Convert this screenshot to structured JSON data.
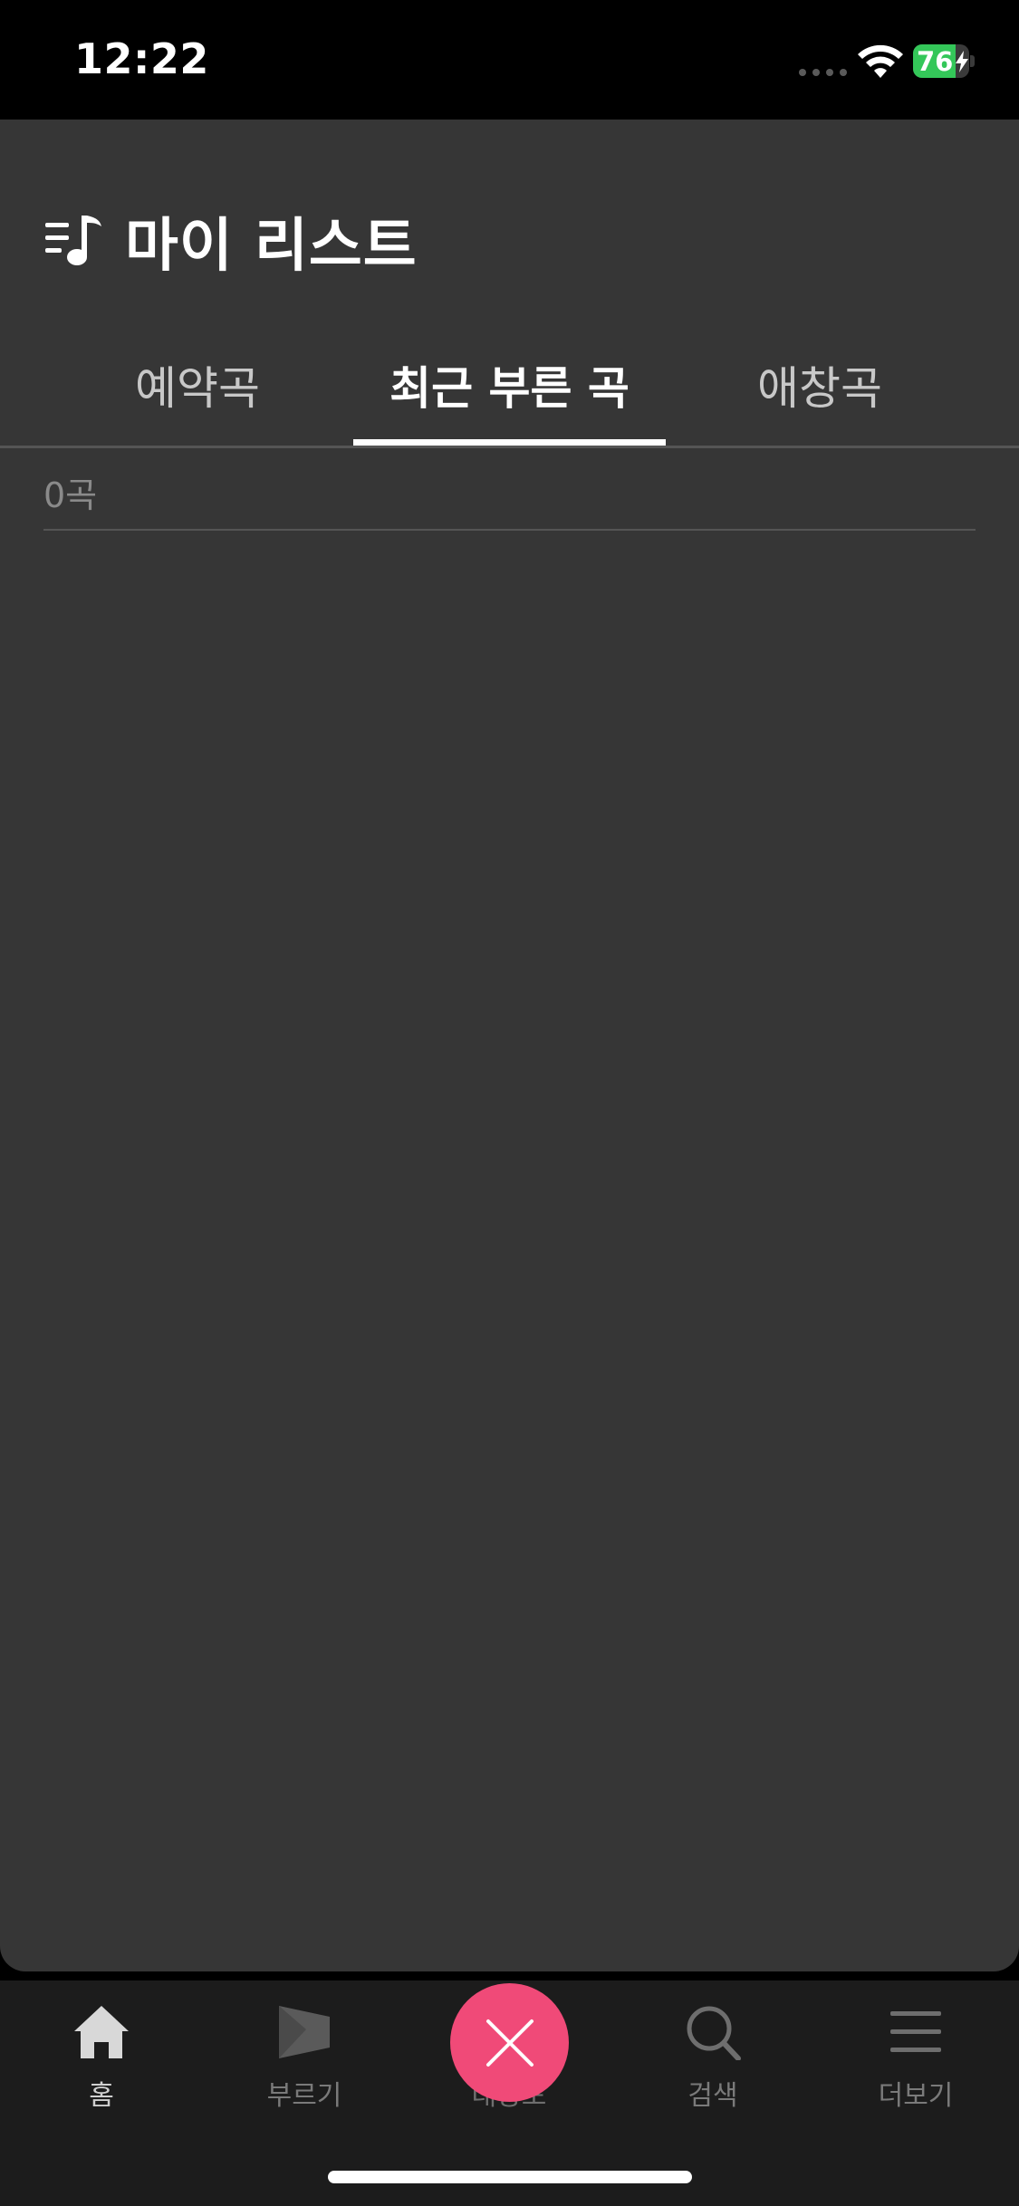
{
  "status_bar": {
    "time": "12:22",
    "battery_level": "76",
    "battery_fraction": 0.76,
    "charging": true
  },
  "header": {
    "title": "마이 리스트",
    "icon": "playlist-music-icon"
  },
  "tabs": [
    {
      "label": "예약곡",
      "active": false
    },
    {
      "label": "최근 부른 곡",
      "active": true
    },
    {
      "label": "애창곡",
      "active": false
    }
  ],
  "list": {
    "count_label": "0곡"
  },
  "tabbar": {
    "items": [
      {
        "label": "홈",
        "icon": "home-icon",
        "active": true
      },
      {
        "label": "부르기",
        "icon": "flag-icon",
        "active": false
      },
      {
        "label": "대상포",
        "icon": "close-icon",
        "active": false
      },
      {
        "label": "검색",
        "icon": "search-icon",
        "active": false
      },
      {
        "label": "더보기",
        "icon": "menu-icon",
        "active": false
      }
    ]
  },
  "colors": {
    "background": "#000000",
    "sheet": "#363636",
    "tabbar": "#1c1c1c",
    "accent": "#f04a78",
    "battery": "#34c759"
  }
}
